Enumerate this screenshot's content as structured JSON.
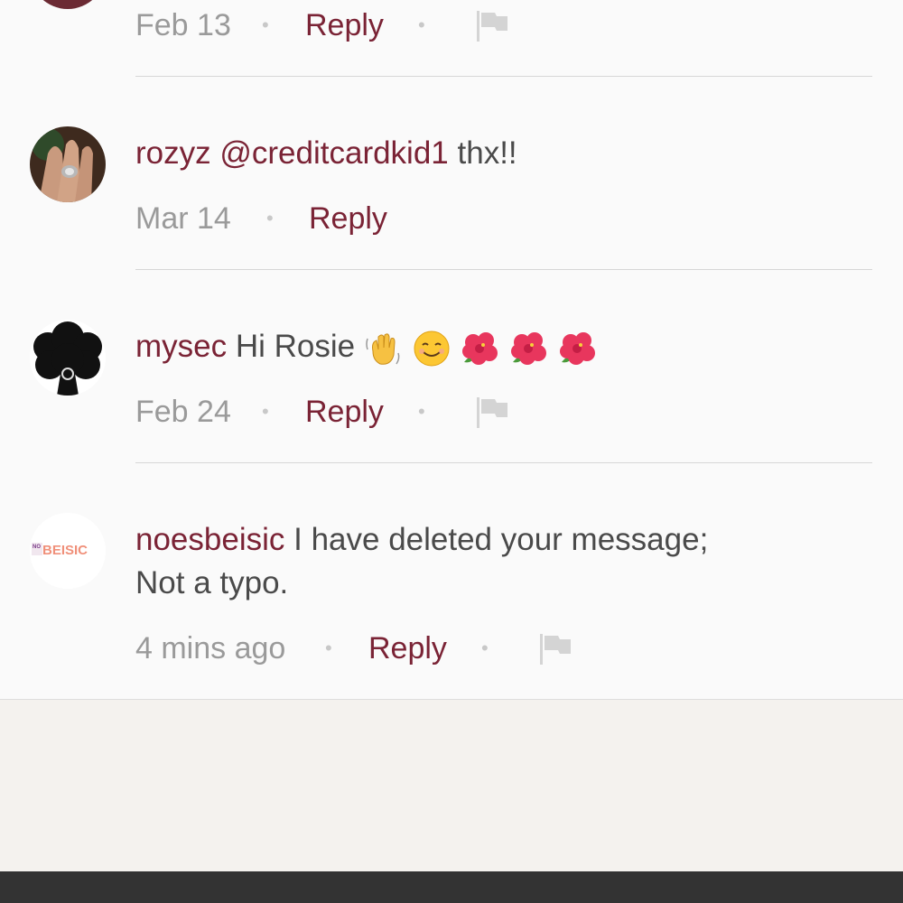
{
  "comments": [
    {
      "date": "Feb 13",
      "reply_label": "Reply"
    },
    {
      "username": "rozyz",
      "mention": "@creditcardkid1",
      "text": "thx!!",
      "date": "Mar 14",
      "reply_label": "Reply"
    },
    {
      "username": "mysec",
      "text": "Hi Rosie",
      "emojis": [
        "waving-hand-emoji",
        "smiling-face-emoji",
        "hibiscus-emoji",
        "hibiscus-emoji",
        "hibiscus-emoji"
      ],
      "date": "Feb 24",
      "reply_label": "Reply"
    },
    {
      "username": "noesbeisic",
      "avatar_text": "BEISIC",
      "avatar_small": "NO",
      "text": "I have deleted your message;",
      "text2": "Not a typo.",
      "date": "4 mins ago",
      "reply_label": "Reply"
    }
  ],
  "separator": "•",
  "colors": {
    "username": "#7a2335",
    "meta": "#9a9a9a",
    "background": "#fafafa",
    "footer": "#f4f2ee",
    "bottom_bar": "#333333"
  }
}
